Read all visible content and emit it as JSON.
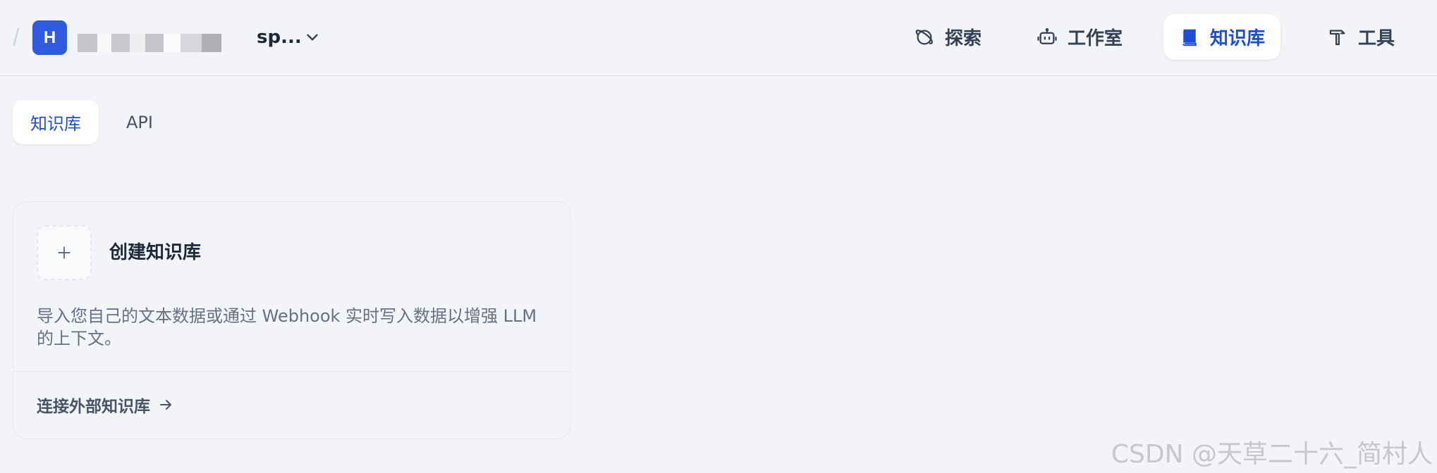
{
  "workspace": {
    "separator": "/",
    "avatar_letter": "H",
    "name_tail": "sp...",
    "blur_colors": [
      "#c4c6cb",
      "#f7f7f8",
      "#c7c9cd",
      "#eceef0",
      "#c4c6cb",
      "#fbfbfc",
      "#d6d7da",
      "#aeb0b4"
    ]
  },
  "nav": {
    "explore": "探索",
    "studio": "工作室",
    "knowledge": "知识库",
    "tools": "工具"
  },
  "tabs": {
    "knowledge": "知识库",
    "api": "API"
  },
  "create_card": {
    "title": "创建知识库",
    "description": "导入您自己的文本数据或通过 Webhook 实时写入数据以增强 LLM 的上下文。",
    "external_link": "连接外部知识库"
  },
  "watermark": "CSDN @天草二十六_简村人",
  "colors": {
    "accent": "#1d4ed8",
    "avatar": "#2e5bdf",
    "background": "#f2f4f7"
  }
}
